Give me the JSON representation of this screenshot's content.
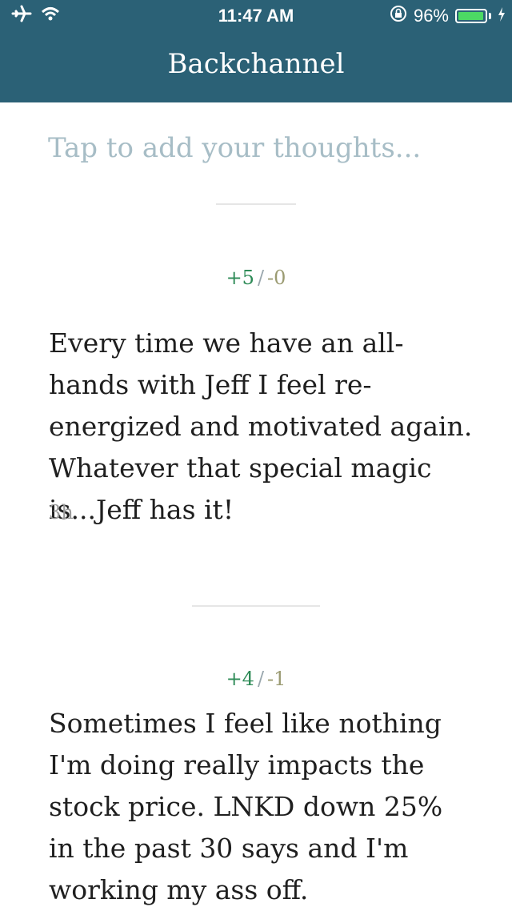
{
  "status_bar": {
    "time": "11:47 AM",
    "battery_percent": "96%",
    "battery_level": 0.96,
    "icons": [
      "airplane-icon",
      "wifi-icon",
      "rotation-lock-icon",
      "battery-icon",
      "charging-icon"
    ]
  },
  "header": {
    "title": "Backchannel"
  },
  "compose": {
    "placeholder": "Tap to add your thoughts..."
  },
  "posts": [
    {
      "up": "+5",
      "slash": "/",
      "down": "-0",
      "text": "Every time we have an all-hands with Jeff I feel re-energized and motivated again. Whatever that special magic is...Jeff has it!",
      "time": "3h"
    },
    {
      "up": "+4",
      "slash": "/",
      "down": "-1",
      "text": "Sometimes I feel like nothing I'm doing really impacts the stock price. LNKD down 25% in the past 30 says and I'm working my ass off."
    }
  ],
  "colors": {
    "header_bg": "#2b6176",
    "upvote": "#2e8b57",
    "downvote": "#9b9b72",
    "placeholder": "#a7bdc6"
  }
}
